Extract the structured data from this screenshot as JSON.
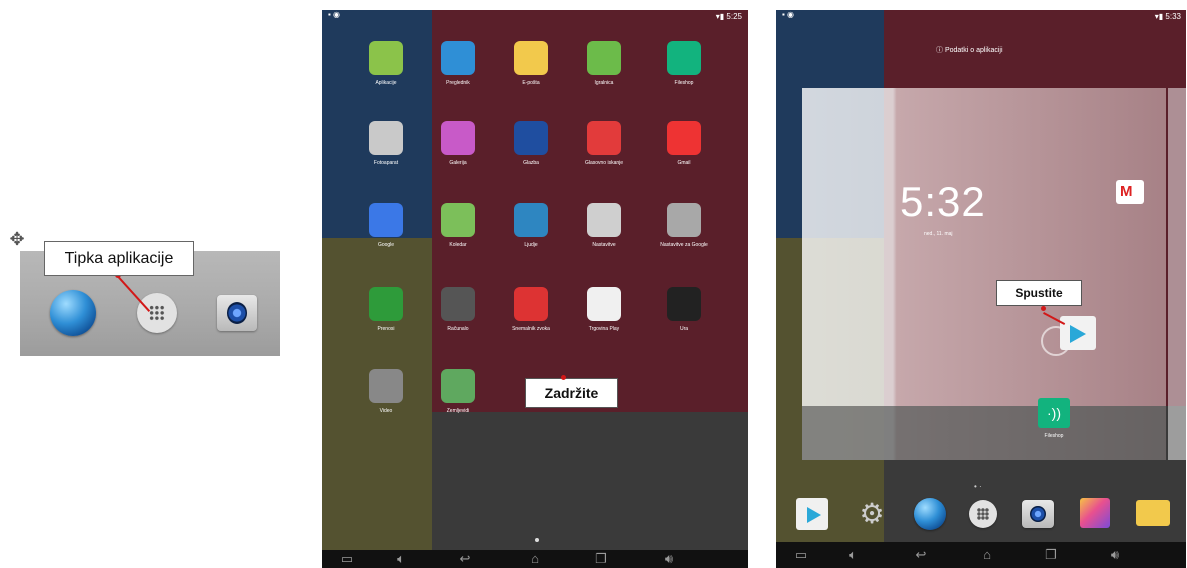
{
  "panel1": {
    "callout_label": "Tipka aplikacije",
    "move_icon": "move-icon",
    "dock_icons": [
      "browser-icon",
      "apps-icon",
      "camera-icon"
    ]
  },
  "panel2": {
    "status_time": "5:25",
    "apps": [
      {
        "label": "Aplikacije",
        "icon": "android-icon",
        "color": "#8bc34a"
      },
      {
        "label": "Preglednik",
        "icon": "globe-icon",
        "color": "#2f8fd6"
      },
      {
        "label": "E-pošta",
        "icon": "mail-icon",
        "color": "#f2c94c"
      },
      {
        "label": "Igralnica",
        "icon": "gift-icon",
        "color": "#6cbb4a"
      },
      {
        "label": "Fileshop",
        "icon": "share-icon",
        "color": "#12b37e"
      },
      {
        "label": "Fotoaparat",
        "icon": "camera-icon",
        "color": "#c9c9c9"
      },
      {
        "label": "Galerija",
        "icon": "gallery-icon",
        "color": "#c85ac8"
      },
      {
        "label": "Glazba",
        "icon": "speaker-icon",
        "color": "#1f4ea0"
      },
      {
        "label": "Glasovno iskanje",
        "icon": "mic-icon",
        "color": "#e23b3b"
      },
      {
        "label": "Gmail",
        "icon": "gmail-icon",
        "color": "#e33"
      },
      {
        "label": "Google",
        "icon": "google-search-icon",
        "color": "#3b78e7"
      },
      {
        "label": "Koledar",
        "icon": "maps-icon",
        "color": "#7cbf5a"
      },
      {
        "label": "Ljudje",
        "icon": "contacts-icon",
        "color": "#2e86c1"
      },
      {
        "label": "Nastavitve",
        "icon": "settings-icon",
        "color": "#cfcfcf"
      },
      {
        "label": "Nastavitve za Google",
        "icon": "google-settings-icon",
        "color": "#a8a8a8"
      },
      {
        "label": "Prenosi",
        "icon": "download-icon",
        "color": "#2e9b3a"
      },
      {
        "label": "Računalo",
        "icon": "calculator-icon",
        "color": "#555"
      },
      {
        "label": "Snemalnik zvoka",
        "icon": "recorder-icon",
        "color": "#d33"
      },
      {
        "label": "Trgovina Play",
        "icon": "play-store-icon",
        "color": "#f0f0f0"
      },
      {
        "label": "Ura",
        "icon": "clock-icon",
        "color": "#222"
      },
      {
        "label": "Video",
        "icon": "clapper-icon",
        "color": "#888"
      },
      {
        "label": "Zemljevidi",
        "icon": "maps-icon",
        "color": "#5fa85f"
      }
    ],
    "callout_label": "Zadržite",
    "nav_icons": [
      "screenshot-icon",
      "volume-down-icon",
      "back-icon",
      "home-icon",
      "recent-apps-icon",
      "volume-up-icon"
    ]
  },
  "panel3": {
    "status_time": "5:33",
    "remove_label": "Podatki o aplikaciji",
    "clock_time": "5:32",
    "clock_date": "ned., 11. maj",
    "callout_label": "Spustite",
    "home_app_label": "Fileshop",
    "dock_icons": [
      "play-store-icon",
      "settings-icon",
      "globe-icon",
      "apps-icon",
      "camera-icon",
      "gallery-icon",
      "mail-icon"
    ],
    "nav_icons": [
      "screenshot-icon",
      "volume-down-icon",
      "back-icon",
      "home-icon",
      "recent-apps-icon",
      "volume-up-icon"
    ]
  },
  "colors": {
    "callout_line": "#d21818",
    "wallpaper_blue": "#1f3a5c",
    "wallpaper_red": "#5a1f2a",
    "wallpaper_olive": "#545230",
    "wallpaper_dark": "#3a3a3a"
  }
}
